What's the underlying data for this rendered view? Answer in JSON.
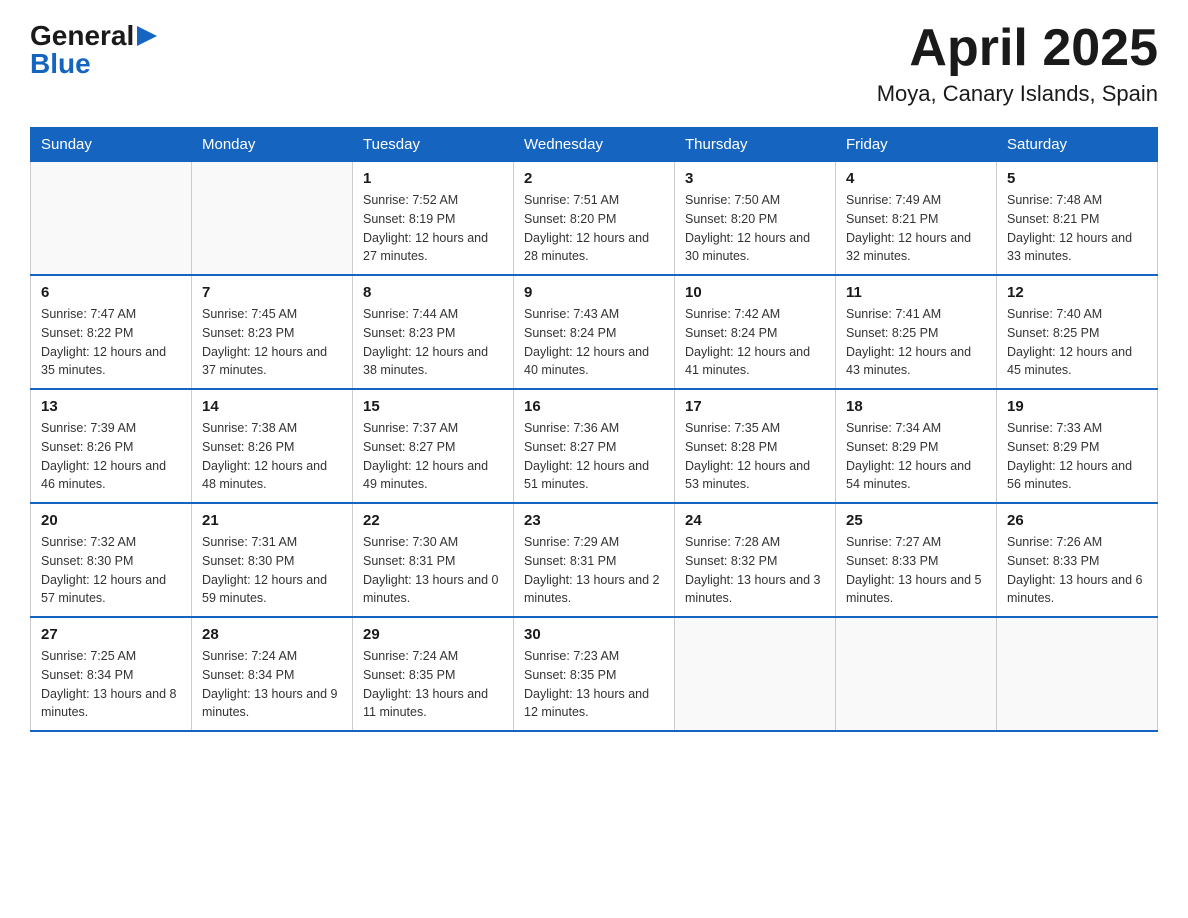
{
  "logo": {
    "general": "General",
    "arrow": "",
    "blue": "Blue"
  },
  "title": "April 2025",
  "subtitle": "Moya, Canary Islands, Spain",
  "days_of_week": [
    "Sunday",
    "Monday",
    "Tuesday",
    "Wednesday",
    "Thursday",
    "Friday",
    "Saturday"
  ],
  "weeks": [
    [
      {
        "day": "",
        "info": ""
      },
      {
        "day": "",
        "info": ""
      },
      {
        "day": "1",
        "info": "Sunrise: 7:52 AM\nSunset: 8:19 PM\nDaylight: 12 hours\nand 27 minutes."
      },
      {
        "day": "2",
        "info": "Sunrise: 7:51 AM\nSunset: 8:20 PM\nDaylight: 12 hours\nand 28 minutes."
      },
      {
        "day": "3",
        "info": "Sunrise: 7:50 AM\nSunset: 8:20 PM\nDaylight: 12 hours\nand 30 minutes."
      },
      {
        "day": "4",
        "info": "Sunrise: 7:49 AM\nSunset: 8:21 PM\nDaylight: 12 hours\nand 32 minutes."
      },
      {
        "day": "5",
        "info": "Sunrise: 7:48 AM\nSunset: 8:21 PM\nDaylight: 12 hours\nand 33 minutes."
      }
    ],
    [
      {
        "day": "6",
        "info": "Sunrise: 7:47 AM\nSunset: 8:22 PM\nDaylight: 12 hours\nand 35 minutes."
      },
      {
        "day": "7",
        "info": "Sunrise: 7:45 AM\nSunset: 8:23 PM\nDaylight: 12 hours\nand 37 minutes."
      },
      {
        "day": "8",
        "info": "Sunrise: 7:44 AM\nSunset: 8:23 PM\nDaylight: 12 hours\nand 38 minutes."
      },
      {
        "day": "9",
        "info": "Sunrise: 7:43 AM\nSunset: 8:24 PM\nDaylight: 12 hours\nand 40 minutes."
      },
      {
        "day": "10",
        "info": "Sunrise: 7:42 AM\nSunset: 8:24 PM\nDaylight: 12 hours\nand 41 minutes."
      },
      {
        "day": "11",
        "info": "Sunrise: 7:41 AM\nSunset: 8:25 PM\nDaylight: 12 hours\nand 43 minutes."
      },
      {
        "day": "12",
        "info": "Sunrise: 7:40 AM\nSunset: 8:25 PM\nDaylight: 12 hours\nand 45 minutes."
      }
    ],
    [
      {
        "day": "13",
        "info": "Sunrise: 7:39 AM\nSunset: 8:26 PM\nDaylight: 12 hours\nand 46 minutes."
      },
      {
        "day": "14",
        "info": "Sunrise: 7:38 AM\nSunset: 8:26 PM\nDaylight: 12 hours\nand 48 minutes."
      },
      {
        "day": "15",
        "info": "Sunrise: 7:37 AM\nSunset: 8:27 PM\nDaylight: 12 hours\nand 49 minutes."
      },
      {
        "day": "16",
        "info": "Sunrise: 7:36 AM\nSunset: 8:27 PM\nDaylight: 12 hours\nand 51 minutes."
      },
      {
        "day": "17",
        "info": "Sunrise: 7:35 AM\nSunset: 8:28 PM\nDaylight: 12 hours\nand 53 minutes."
      },
      {
        "day": "18",
        "info": "Sunrise: 7:34 AM\nSunset: 8:29 PM\nDaylight: 12 hours\nand 54 minutes."
      },
      {
        "day": "19",
        "info": "Sunrise: 7:33 AM\nSunset: 8:29 PM\nDaylight: 12 hours\nand 56 minutes."
      }
    ],
    [
      {
        "day": "20",
        "info": "Sunrise: 7:32 AM\nSunset: 8:30 PM\nDaylight: 12 hours\nand 57 minutes."
      },
      {
        "day": "21",
        "info": "Sunrise: 7:31 AM\nSunset: 8:30 PM\nDaylight: 12 hours\nand 59 minutes."
      },
      {
        "day": "22",
        "info": "Sunrise: 7:30 AM\nSunset: 8:31 PM\nDaylight: 13 hours\nand 0 minutes."
      },
      {
        "day": "23",
        "info": "Sunrise: 7:29 AM\nSunset: 8:31 PM\nDaylight: 13 hours\nand 2 minutes."
      },
      {
        "day": "24",
        "info": "Sunrise: 7:28 AM\nSunset: 8:32 PM\nDaylight: 13 hours\nand 3 minutes."
      },
      {
        "day": "25",
        "info": "Sunrise: 7:27 AM\nSunset: 8:33 PM\nDaylight: 13 hours\nand 5 minutes."
      },
      {
        "day": "26",
        "info": "Sunrise: 7:26 AM\nSunset: 8:33 PM\nDaylight: 13 hours\nand 6 minutes."
      }
    ],
    [
      {
        "day": "27",
        "info": "Sunrise: 7:25 AM\nSunset: 8:34 PM\nDaylight: 13 hours\nand 8 minutes."
      },
      {
        "day": "28",
        "info": "Sunrise: 7:24 AM\nSunset: 8:34 PM\nDaylight: 13 hours\nand 9 minutes."
      },
      {
        "day": "29",
        "info": "Sunrise: 7:24 AM\nSunset: 8:35 PM\nDaylight: 13 hours\nand 11 minutes."
      },
      {
        "day": "30",
        "info": "Sunrise: 7:23 AM\nSunset: 8:35 PM\nDaylight: 13 hours\nand 12 minutes."
      },
      {
        "day": "",
        "info": ""
      },
      {
        "day": "",
        "info": ""
      },
      {
        "day": "",
        "info": ""
      }
    ]
  ]
}
